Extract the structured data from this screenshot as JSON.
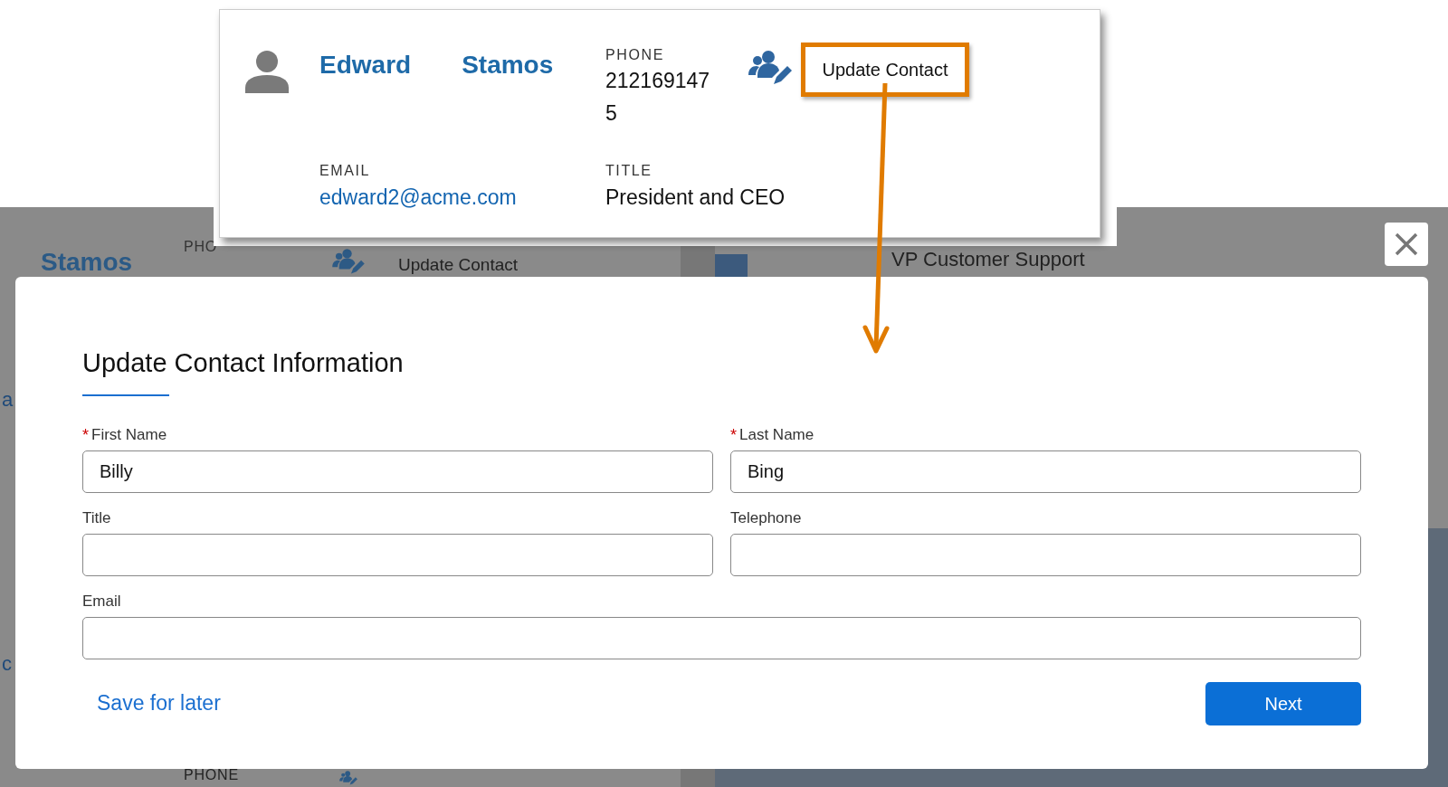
{
  "background": {
    "edge_texts": [
      "a",
      "c"
    ],
    "top_card": {
      "name": "Stamos",
      "phone_label": "PHO",
      "action": "Update Contact"
    },
    "right_title": "VP Customer Support",
    "bottom_card": {
      "phone_label": "PHONE"
    }
  },
  "callout": {
    "first_name": "Edward",
    "last_name": "Stamos",
    "phone_label": "PHONE",
    "phone_lines": [
      "212169147",
      "5"
    ],
    "action": "Update Contact",
    "email_label": "EMAIL",
    "email": "edward2@acme.com",
    "title_label": "TITLE",
    "title": "President and CEO"
  },
  "modal": {
    "title": "Update Contact Information",
    "required_mark": "*",
    "rows": [
      [
        {
          "label": "First Name",
          "required": true,
          "value": "Billy"
        },
        {
          "label": "Last Name",
          "required": true,
          "value": "Bing"
        }
      ],
      [
        {
          "label": "Title",
          "required": false
        },
        {
          "label": "Telephone",
          "required": false
        }
      ],
      [
        {
          "label": "Email",
          "required": false
        }
      ]
    ],
    "secondary_action": "Save for later",
    "primary_action": "Next"
  }
}
